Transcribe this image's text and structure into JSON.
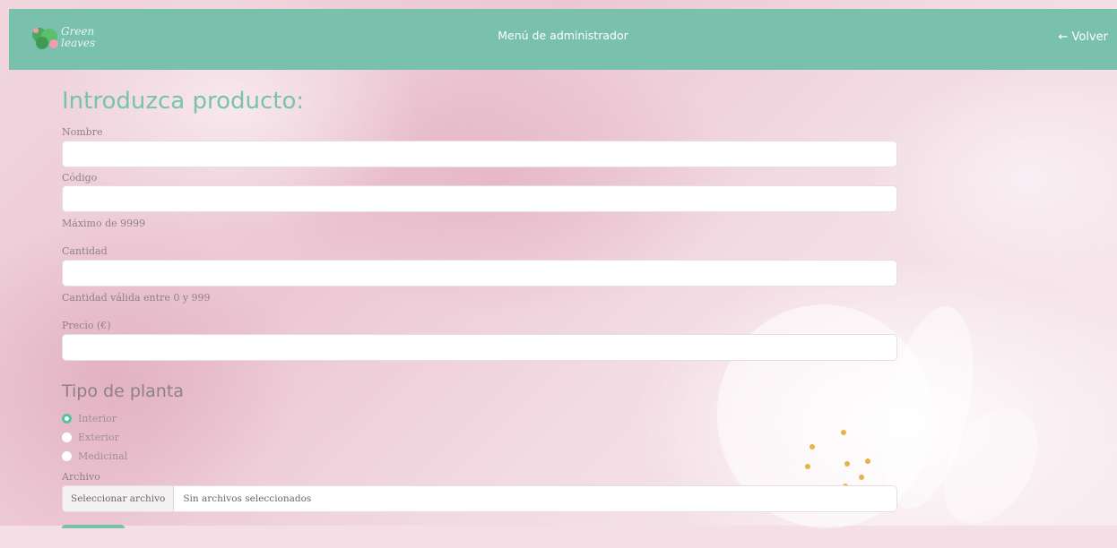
{
  "header": {
    "logo_text_1": "Green",
    "logo_text_2": "leaves",
    "title": "Menú de administrador",
    "back_label": "← Volver"
  },
  "form": {
    "heading": "Introduzca producto:",
    "name_label": "Nombre",
    "name_value": "",
    "code_label": "Código",
    "code_value": "",
    "code_help": "Máximo de 9999",
    "quantity_label": "Cantidad",
    "quantity_value": "",
    "quantity_help": "Cantidad válida entre 0 y 999",
    "price_label": "Precio (€)",
    "price_value": "",
    "plant_type_heading": "Tipo de planta",
    "plant_types": [
      {
        "label": "Interior",
        "checked": true
      },
      {
        "label": "Exterior",
        "checked": false
      },
      {
        "label": "Medicinal",
        "checked": false
      }
    ],
    "file_label": "Archivo",
    "file_button": "Seleccionar archivo",
    "file_status": "Sin archivos seleccionados"
  },
  "colors": {
    "accent": "#79c1ac",
    "heading": "#78c4ab",
    "radio_checked": "#57c2a0"
  }
}
